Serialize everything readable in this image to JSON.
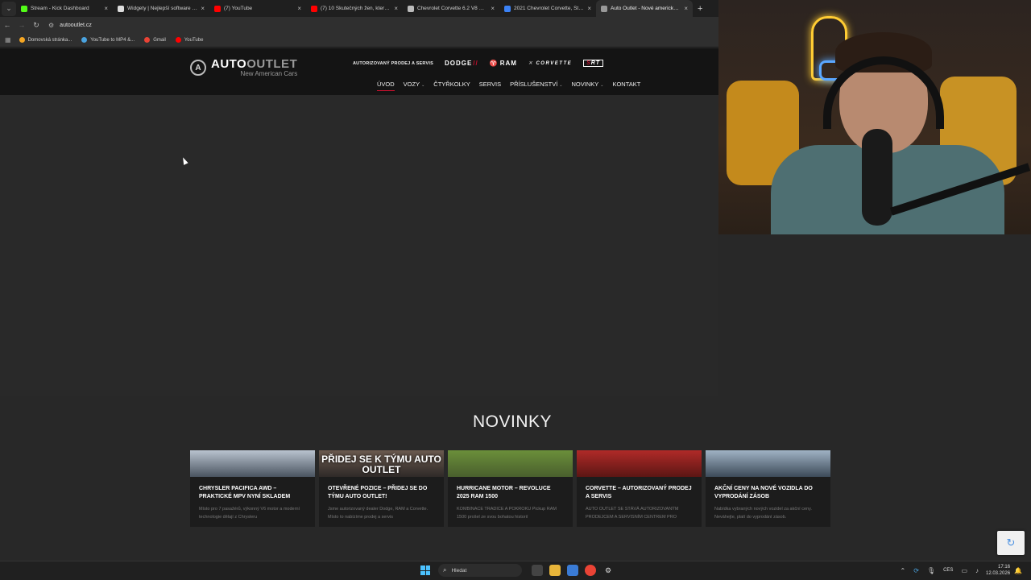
{
  "browser": {
    "tabs": [
      {
        "title": "Stream - Kick Dashboard",
        "favicon_color": "#53fc18",
        "active": false
      },
      {
        "title": "Widgety | Nejlepší software pro...",
        "favicon_color": "#dddddd",
        "active": false
      },
      {
        "title": "(7) YouTube",
        "favicon_color": "#ff0000",
        "active": false
      },
      {
        "title": "(7) 10 Skutečných žen, které jso...",
        "favicon_color": "#ff0000",
        "active": false
      },
      {
        "title": "Chevrolet Corvette 6.2 V8 Sting...",
        "favicon_color": "#bbbbbb",
        "active": false
      },
      {
        "title": "2021 Chevrolet Corvette, Sting...",
        "favicon_color": "#3b82f6",
        "active": false
      },
      {
        "title": "Auto Outlet - Nové americké v...",
        "favicon_color": "#999999",
        "active": true
      }
    ],
    "close_glyph": "×",
    "new_tab_glyph": "+",
    "url": "autooutlet.cz",
    "bookmarks": [
      {
        "label": "Domovská stránka...",
        "color": "#f5a623"
      },
      {
        "label": "YouTube to MP4 &...",
        "color": "#4aa3df"
      },
      {
        "label": "Gmail",
        "color": "#ea4335"
      },
      {
        "label": "YouTube",
        "color": "#ff0000"
      }
    ]
  },
  "site": {
    "logo": {
      "main_a": "AUTO",
      "main_b": "OUTLET",
      "sub": "New American Cars",
      "mark": "A"
    },
    "brand_tagline": "AUTORIZOVANÝ PRODEJ A SERVIS",
    "brands": {
      "dodge": "DODGE",
      "ram": "RAM",
      "corvette": "CORVETTE",
      "srt_a": "S",
      "srt_b": "RT"
    },
    "nav": [
      {
        "label": "ÚVOD",
        "active": true,
        "has_caret": false
      },
      {
        "label": "VOZY",
        "active": false,
        "has_caret": true
      },
      {
        "label": "ČTYŘKOLKY",
        "active": false,
        "has_caret": false
      },
      {
        "label": "SERVIS",
        "active": false,
        "has_caret": false
      },
      {
        "label": "PŘÍSLUŠENSTVÍ",
        "active": false,
        "has_caret": true
      },
      {
        "label": "NOVINKY",
        "active": false,
        "has_caret": true
      },
      {
        "label": "KONTAKT",
        "active": false,
        "has_caret": false
      }
    ],
    "caret_glyph": "⌄",
    "news_heading": "NOVINKY",
    "news": [
      {
        "title": "CHRYSLER PACIFICA AWD – PRAKTICKÉ MPV NYNÍ SKLADEM",
        "text": "Místo pro 7 pasažérů, výkonný V6 motor a moderní technologie dělají z Chrysleru",
        "img_top": "#b9c3cf",
        "img_bottom": "#4a5460",
        "overlay": ""
      },
      {
        "title": "OTEVŘENÉ POZICE – PŘIDEJ SE DO TÝMU AUTO OUTLET!",
        "text": "Jsme autorizovaný dealer Dodge, RAM a Corvette. Místo to nabízíme prodej a servis",
        "img_top": "#6b5a4f",
        "img_bottom": "#2f2a28",
        "overlay": "PŘIDEJ SE K TÝMU AUTO OUTLET"
      },
      {
        "title": "HURRICANE MOTOR – REVOLUCE 2025 RAM 1500",
        "text": "KOMBINACE TRADICE A POKROKU Pickup RAM 1500 prošel ze svou bohatou historií",
        "img_top": "#6b8f3a",
        "img_bottom": "#4a5f2d",
        "overlay": ""
      },
      {
        "title": "CORVETTE – AUTORIZOVANÝ PRODEJ A SERVIS",
        "text": "AUTO OUTLET SE STÁVÁ AUTORIZOVANÝM PRODEJCEM A SERVISNÍM CENTREM PRO",
        "img_top": "#b02a28",
        "img_bottom": "#5c1614",
        "overlay": ""
      },
      {
        "title": "AKČNÍ CENY NA NOVÉ VOZIDLA DO VYPRODÁNÍ ZÁSOB",
        "text": "Nabídka vybraných nových vozidel za akční ceny. Neváhejte, platí do vyprodání zásob.",
        "img_top": "#9fb2c4",
        "img_bottom": "#3c4a58",
        "overlay": ""
      }
    ]
  },
  "taskbar": {
    "search_label": "Hledat",
    "language": "CES",
    "time": "17:16",
    "date": "12.03.2026"
  }
}
